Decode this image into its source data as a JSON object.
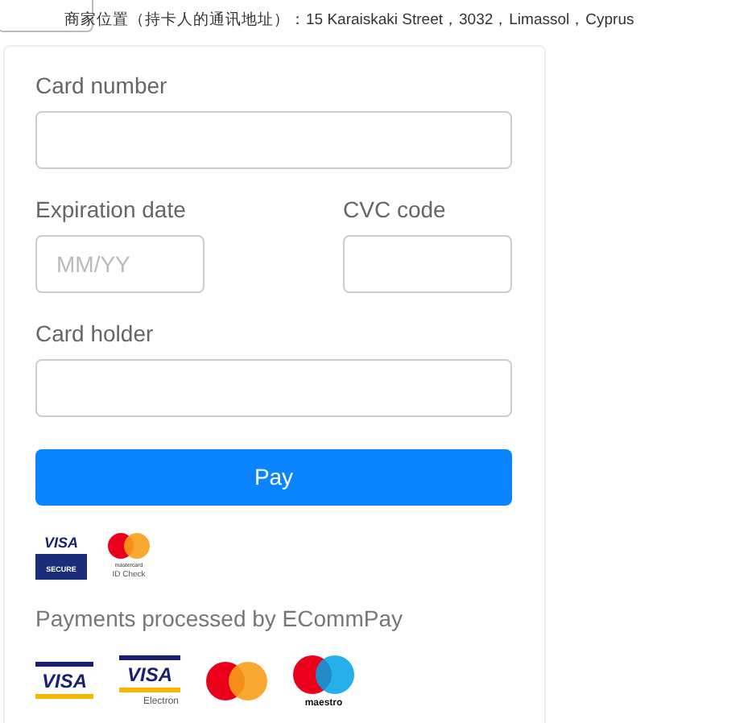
{
  "address": "商家位置（持卡人的通讯地址）：15 Karaiskaki Street，3032，Limassol，Cyprus",
  "fields": [
    {
      "label": "Card number",
      "kind": "wide"
    },
    {
      "label": "Expiration date",
      "placeholder": "MM/YY",
      "kind": "narrow"
    },
    {
      "label": "CVC code",
      "kind": "narrow"
    },
    {
      "label": "Card holder",
      "kind": "wide"
    }
  ],
  "pay_button": "Pay",
  "security_logos": [
    {
      "kind": "visa-secure",
      "words": [
        "VISA",
        "SECURE"
      ]
    },
    {
      "kind": "mastercard-check",
      "words": [
        "mastercard",
        "ID Check"
      ]
    }
  ],
  "processed_by": "Payments processed by ECommPay",
  "card_logos": [
    {
      "kind": "visa",
      "words": [
        "VISA"
      ]
    },
    {
      "kind": "visa-electron",
      "words": [
        "VISA",
        "Electron"
      ]
    },
    {
      "kind": "mastercard"
    },
    {
      "kind": "maestro",
      "words": [
        "maestro"
      ]
    }
  ]
}
